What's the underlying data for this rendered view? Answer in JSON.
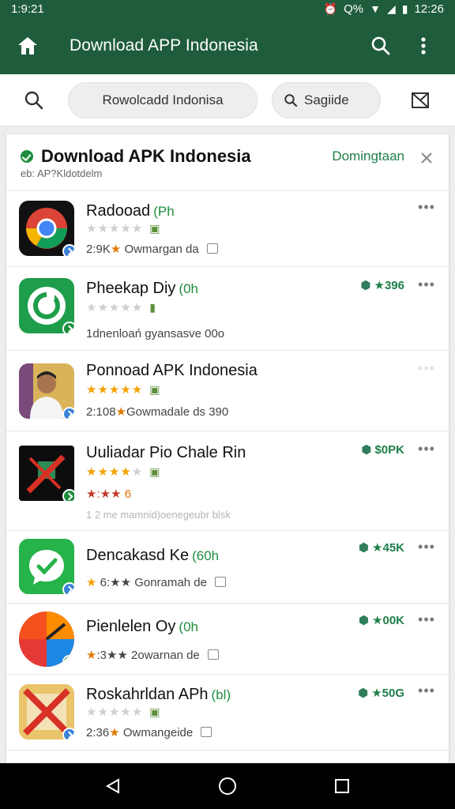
{
  "status_bar": {
    "time_left": "1:9:21",
    "battery": "Q%",
    "time_right": "12:26"
  },
  "app_bar": {
    "title": "Download APP Indonesia"
  },
  "search": {
    "value": "Rowolcadd Indonisa",
    "chip_label": "Sagiide"
  },
  "card": {
    "title": "Download APK Indonesia",
    "subtitle": "eb: AP?Kldotdelm",
    "link": "Domingtaan"
  },
  "apps": [
    {
      "name": "Radooad",
      "tag": "(Ph",
      "stars_on": 0,
      "meta": "2:9K",
      "meta_star": "★",
      "meta_rest": "Owmargan da",
      "price": "",
      "icon": "chrome"
    },
    {
      "name": "Pheekap Diy",
      "tag": "(0h",
      "stars_on": 0,
      "meta": "1dnenloań gyansasve  00o",
      "meta_star": "",
      "meta_rest": "",
      "price": "★396",
      "icon": "green-circle"
    },
    {
      "name": "Ponnoad APK Indonesia",
      "tag": "",
      "stars_on": 5,
      "meta": "2:108",
      "meta_star": "★",
      "meta_rest": "Gowmadale ds  390",
      "price": "",
      "icon": "portrait"
    },
    {
      "name": "Uuliadar Pio Chale Rin",
      "tag": "",
      "stars_on": 4,
      "rating_line": "★:★★",
      "rating_num": "6",
      "small_line": "1 2 me mamnid)oenegeubr blsk",
      "price": "$0PK",
      "icon": "dark-x"
    },
    {
      "name": "Dencakasd Ke",
      "tag": "(60h",
      "stars_on": 0,
      "meta": "",
      "meta_star": "★",
      "meta_rest": "6:★★ Gonramah de",
      "price": "★45K",
      "icon": "check"
    },
    {
      "name": "Pienlelen Oy",
      "tag": "(0h",
      "stars_on": 0,
      "meta": "",
      "meta_star": "★",
      "meta_rest": ":3★★ 2owarnan de",
      "price": "★00K",
      "icon": "colorful"
    },
    {
      "name": "Roskahrldan APh",
      "tag": "(bl)",
      "stars_on": 0,
      "meta": "2:36",
      "meta_star": "★",
      "meta_rest": "Owmangeide",
      "price": "★50G",
      "icon": "cross"
    }
  ],
  "colors": {
    "primary": "#1f5c3c",
    "accent_green": "#1e8e3e",
    "star": "#f4a100"
  }
}
